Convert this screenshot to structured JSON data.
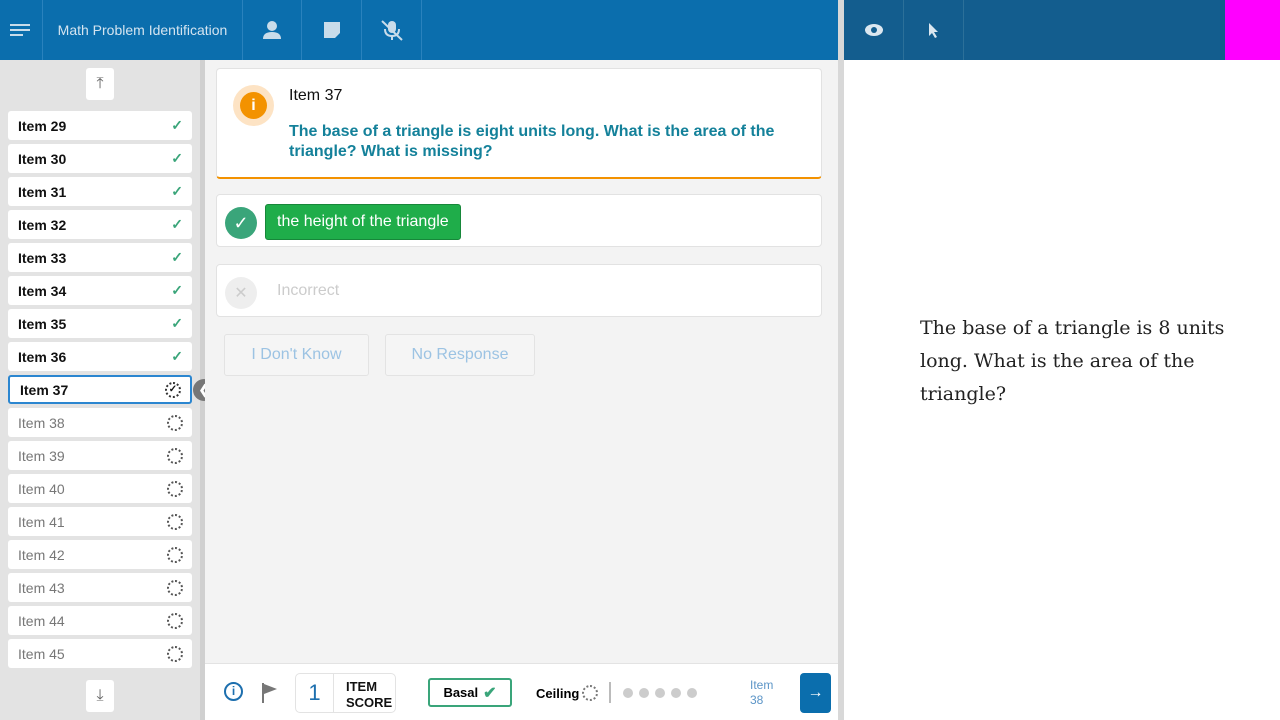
{
  "header": {
    "title": "Math Problem Identification",
    "icons": [
      "menu-icon",
      "person-icon",
      "note-icon",
      "mic-off-icon"
    ],
    "right_icons": [
      "eye-icon",
      "pointer-icon"
    ]
  },
  "sidebar": {
    "items": [
      {
        "label": "Item 29",
        "status": "done"
      },
      {
        "label": "Item 30",
        "status": "done"
      },
      {
        "label": "Item 31",
        "status": "done"
      },
      {
        "label": "Item 32",
        "status": "done"
      },
      {
        "label": "Item 33",
        "status": "done"
      },
      {
        "label": "Item 34",
        "status": "done"
      },
      {
        "label": "Item 35",
        "status": "done"
      },
      {
        "label": "Item 36",
        "status": "done"
      },
      {
        "label": "Item 37",
        "status": "current"
      },
      {
        "label": "Item 38",
        "status": "pending"
      },
      {
        "label": "Item 39",
        "status": "pending"
      },
      {
        "label": "Item 40",
        "status": "pending"
      },
      {
        "label": "Item 41",
        "status": "pending"
      },
      {
        "label": "Item 42",
        "status": "pending"
      },
      {
        "label": "Item 43",
        "status": "pending"
      },
      {
        "label": "Item 44",
        "status": "pending"
      },
      {
        "label": "Item 45",
        "status": "pending"
      }
    ]
  },
  "question": {
    "title": "Item 37",
    "text": "The base of a triangle is eight units long. What is the area of the triangle? What is missing?"
  },
  "answers": {
    "correct": "the height of the triangle",
    "incorrect": "Incorrect",
    "dont_know": "I Don't Know",
    "no_response": "No Response"
  },
  "footer": {
    "score": "1",
    "score_label_1": "ITEM",
    "score_label_2": "SCORE",
    "basal": "Basal",
    "ceiling": "Ceiling",
    "next_label_1": "Item",
    "next_label_2": "38"
  },
  "stimulus": {
    "text": "The base of a triangle is 8 units long. What is the area of the triangle?"
  },
  "colors": {
    "header": "#0b6ead",
    "accent_orange": "#f39200",
    "correct_green": "#1fad4a",
    "check": "#3aa57a"
  }
}
